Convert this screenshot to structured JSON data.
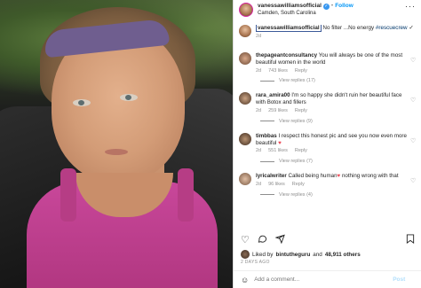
{
  "post": {
    "username": "vanessawilliamsofficial",
    "verified_mark": "✓",
    "follow_label": "Follow",
    "location": "Camden, South Carolina",
    "more_icon": "more-horizontal-icon"
  },
  "caption": {
    "username": "vanessawilliamsofficial",
    "text": "No filter ...No energy ",
    "hashtag": "#rescuecrew",
    "extra": "✓",
    "time": "2d"
  },
  "comments": [
    {
      "username": "thepageantconsultancy",
      "text": "You will always be one of the most beautiful women in the world",
      "time": "2d",
      "likes": "743 likes",
      "reply": "Reply",
      "view_replies": "View replies (17)"
    },
    {
      "username": "rara_amira00",
      "text": "I'm so happy she didn't ruin her beautiful face with Botox and fillers",
      "time": "2d",
      "likes": "259 likes",
      "reply": "Reply",
      "view_replies": "View replies (9)"
    },
    {
      "username": "timbbas",
      "text": "I respect this honest pic and see you now even more beautiful ",
      "emoji": "♥",
      "time": "2d",
      "likes": "551 likes",
      "reply": "Reply",
      "view_replies": "View replies (7)"
    },
    {
      "username": "lyricalwriter",
      "text": "Called being human",
      "emoji": "♥",
      "text_after": " nothing wrong with that",
      "time": "2d",
      "likes": "96 likes",
      "reply": "Reply",
      "view_replies": "View replies (4)"
    }
  ],
  "likes_summary": {
    "prefix": "Liked by ",
    "user": "bintutheguru",
    "middle": " and ",
    "count": "48,911 others"
  },
  "date": "2 DAYS AGO",
  "add_comment": {
    "placeholder": "Add a comment...",
    "post_label": "Post"
  },
  "icons": {
    "like": "heart-icon",
    "comment": "comment-icon",
    "share": "share-icon",
    "save": "bookmark-icon",
    "emoji": "smile-icon"
  },
  "colors": {
    "accent": "#0095f6",
    "verified": "#3897f0",
    "muted": "#8e8e8e",
    "text": "#262626"
  }
}
